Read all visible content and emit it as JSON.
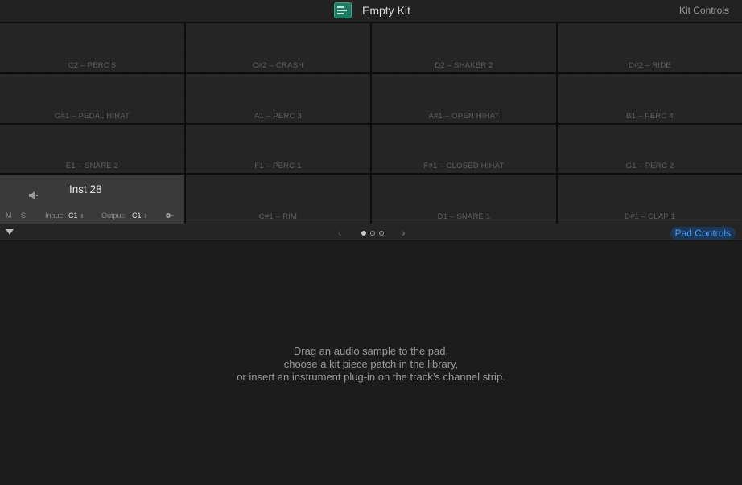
{
  "header": {
    "title": "Empty Kit",
    "kit_controls": "Kit Controls"
  },
  "pads": [
    {
      "label": "C2 – PERC 5"
    },
    {
      "label": "C#2 – CRASH"
    },
    {
      "label": "D2 – SHAKER 2"
    },
    {
      "label": "D#2 – RIDE"
    },
    {
      "label": "G#1 – PEDAL HIHAT"
    },
    {
      "label": "A1 – PERC 3"
    },
    {
      "label": "A#1 – OPEN HIHAT"
    },
    {
      "label": "B1 – PERC 4"
    },
    {
      "label": "E1 – SNARE 2"
    },
    {
      "label": "F1 – PERC 1"
    },
    {
      "label": "F#1 – CLOSED HIHAT"
    },
    {
      "label": "G1 – PERC 2"
    },
    {
      "label": ""
    },
    {
      "label": "C#1 – RIM"
    },
    {
      "label": "D1 – SNARE 1"
    },
    {
      "label": "D#1 – CLAP 1"
    }
  ],
  "selected_pad": {
    "name": "Inst 28",
    "mute": "M",
    "solo": "S",
    "input_label": "Input:",
    "input_value": "C1",
    "output_label": "Output:",
    "output_value": "C1"
  },
  "nav": {
    "prev": "‹",
    "next": "›",
    "page_count": 3,
    "active_page": 1,
    "pad_controls": "Pad Controls"
  },
  "message": {
    "line1": "Drag an audio sample to the pad,",
    "line2": "choose a kit piece patch in the library,",
    "line3": "or insert an instrument plug-in on the track’s channel strip."
  }
}
